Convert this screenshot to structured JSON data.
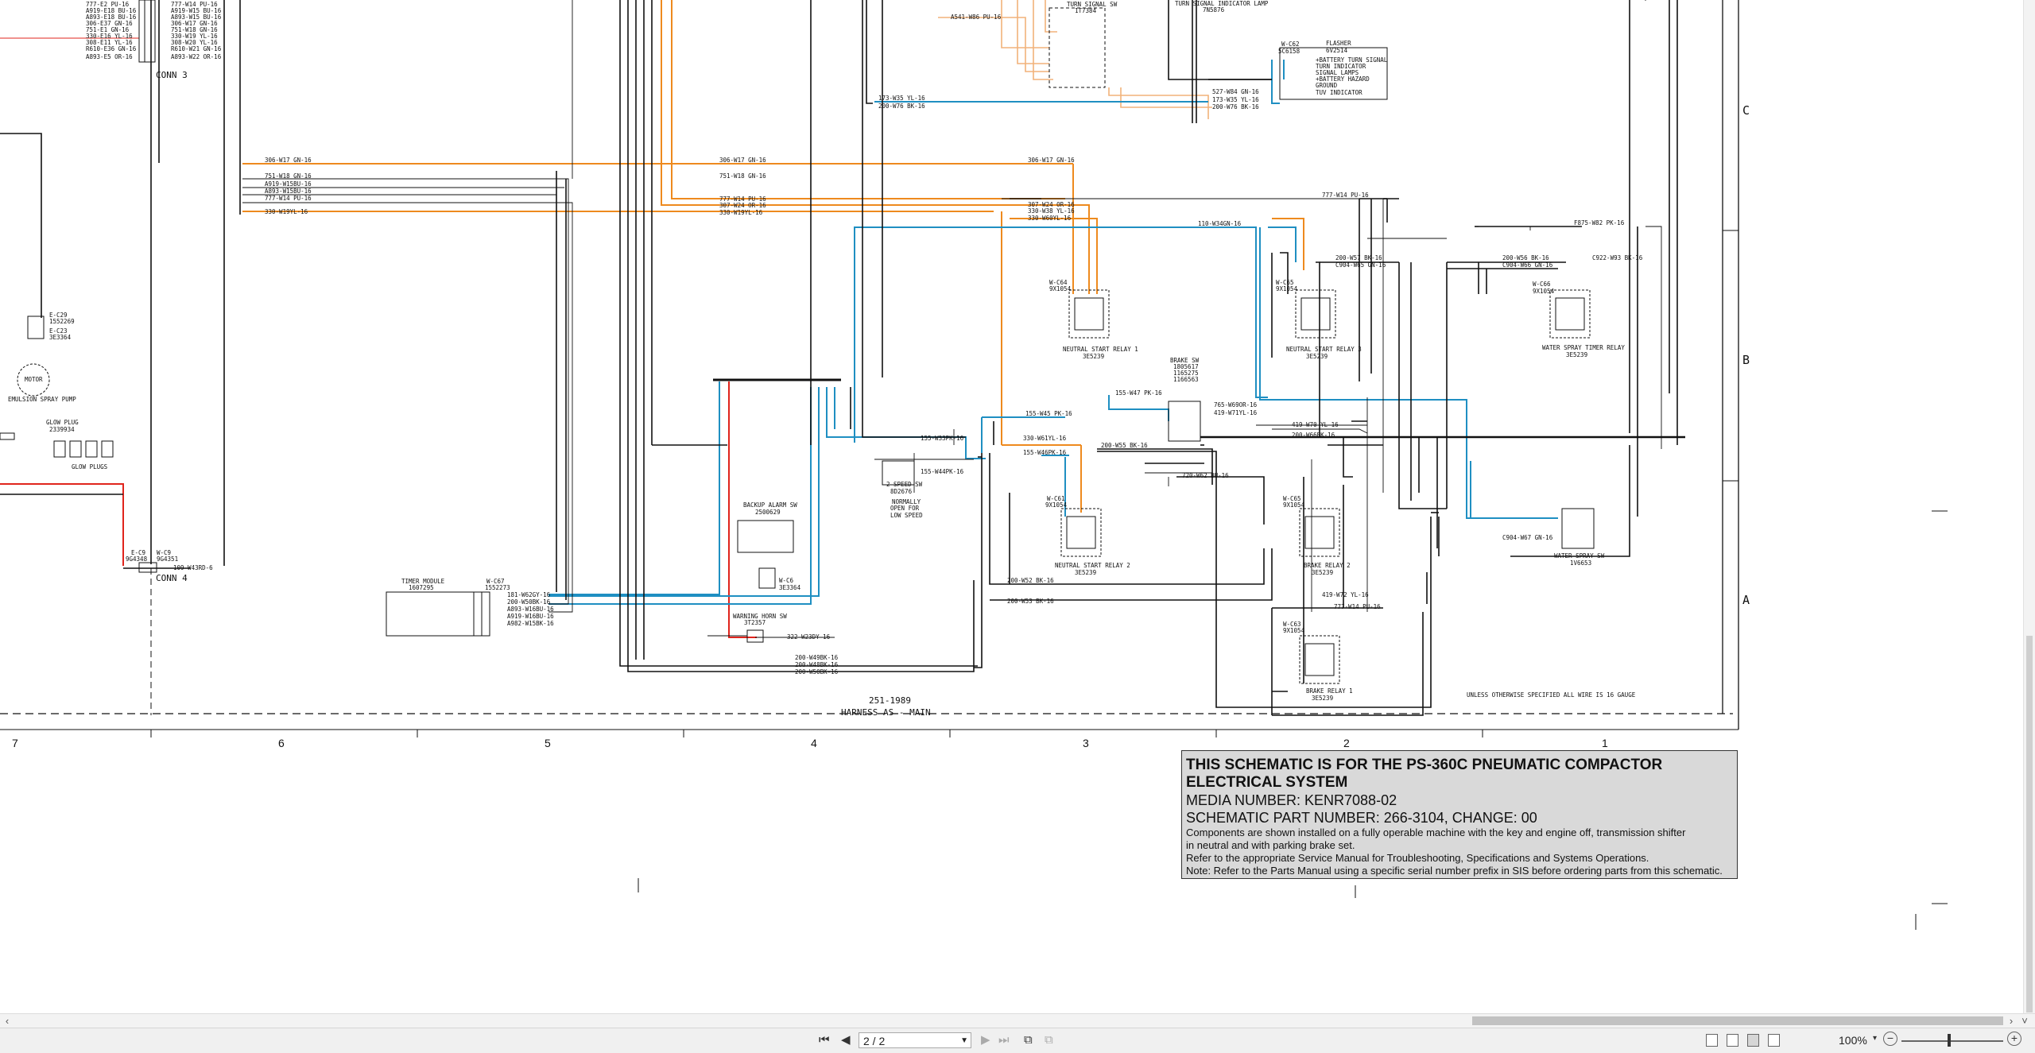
{
  "schematic": {
    "harness_number": "251-1989",
    "harness_name": "HARNESS AS - MAIN",
    "connectors": [
      "CONN 3",
      "CONN 4"
    ],
    "zone_rows": [
      "C",
      "B",
      "A"
    ],
    "zone_columns": [
      "7",
      "6",
      "5",
      "4",
      "3",
      "2",
      "1"
    ],
    "wire_colors": {
      "orange": "#ee8a1e",
      "light_orange": "#f2b27a",
      "blue": "#1f8fc2",
      "red": "#e0241c",
      "black": "#111111"
    },
    "wire_gauge_note": "UNLESS OTHERWISE SPECIFIED ALL WIRE IS 16 GAUGE",
    "components": {
      "turn_signal_sw": [
        "TURN SIGNAL SW",
        "1T7384"
      ],
      "turn_signal_lamp": [
        "TURN SIGNAL INDICATOR LAMP",
        "7N5876"
      ],
      "flasher": [
        "FLASHER",
        "6V2514"
      ],
      "flasher_pins": [
        "+BATTERY TURN SIGNAL",
        "TURN INDICATOR",
        "SIGNAL LAMPS",
        "+BATTERY HAZARD",
        "GROUND",
        "TUV INDICATOR"
      ],
      "emulsion_pump": "EMULSION SPRAY PUMP",
      "motor": "MOTOR",
      "glow_plug": [
        "GLOW PLUG",
        "2339934"
      ],
      "glow_plugs": "GLOW PLUGS",
      "neutral_start_relay_1": [
        "NEUTRAL START RELAY 1",
        "3E5239"
      ],
      "neutral_start_relay_2": [
        "NEUTRAL START RELAY 2",
        "3E5239"
      ],
      "neutral_start_relay_3": [
        "NEUTRAL START RELAY 3",
        "3E5239"
      ],
      "water_spray_timer_relay": [
        "WATER SPRAY TIMER RELAY",
        "3E5239"
      ],
      "brake_relay_1": [
        "BRAKE RELAY 1",
        "3E5239"
      ],
      "brake_relay_2": [
        "BRAKE RELAY 2",
        "3E5239"
      ],
      "brake_sw": [
        "BRAKE SW",
        "1805617",
        "1165275",
        "1166563"
      ],
      "two_speed_sw": [
        "2 SPEED SW",
        "8D2676"
      ],
      "two_speed_note": [
        "NORMALLY",
        "OPEN FOR",
        "LOW SPEED"
      ],
      "water_spray_sw": [
        "WATER SPRAY SW",
        "1V6653"
      ],
      "backup_alarm_sw": [
        "BACKUP ALARM SW",
        "2500629"
      ],
      "warning_horn_sw": [
        "WARNING HORN SW",
        "3T2357"
      ],
      "timer_module": [
        "TIMER MODULE",
        "1607295"
      ]
    },
    "wire_labels": {
      "conn3": [
        "777-E2 PU-16",
        "A919-E18 BU-16",
        "A893-E18 BU-16",
        "306-E37 GN-16",
        "751-E1 GN-16",
        "330-E16 YL-16",
        "308-E11 YL-16",
        "R610-E36 GN-16",
        "A893-E5 OR-16"
      ],
      "conn3_right": [
        "777-W14 PU-16",
        "A919-W15 BU-16",
        "A893-W15 BU-16",
        "306-W17 GN-16",
        "751-W18 GN-16",
        "330-W19 YL-16",
        "308-W20 YL-16",
        "R610-W21 GN-16",
        "A893-W22 OR-16"
      ],
      "main_left": [
        "306-W17 GN-16",
        "751-W18 GN-16",
        "A919-W15BU-16",
        "A893-W15BU-16",
        "777-W14 PU-16",
        "330-W19YL-16"
      ],
      "main_mid": [
        "306-W17 GN-16",
        "751-W18 GN-16",
        "777-W14 PU-16",
        "307-W24 OR-16",
        "330-W19YL-16"
      ],
      "main_right": [
        "306-W17 GN-16",
        "307-W24 OR-16",
        "330-W38 YL-16",
        "330-W60YL-16",
        "110-W34GN-16",
        "777-W14 PU-16"
      ],
      "top": [
        "A541-W86 PU-16",
        "173-W35 YL-16",
        "200-W76 BK-16",
        "527-W84 GN-16",
        "173-W35 YL-16",
        "200-W76 BK-16"
      ],
      "right": [
        "F875-W82 PK-16",
        "200-W56 BK-16",
        "C904-W66 GN-16",
        "C922-W93 BK-16",
        "200-W57 BK-16",
        "C904-W65 GN-16"
      ],
      "center": [
        "155-W47 PK-16",
        "765-W69OR-16",
        "419-W71YL-16",
        "155-W45 PK-16",
        "419-W70 YL-16",
        "155-W33PK-16",
        "330-W61YL-16",
        "200-W66BK-16",
        "155-W46PK-16",
        "200-W55 BK-16",
        "155-W44PK-16",
        "720-W62 BU-16",
        "200-W52 BK-16",
        "200-W53 BK-16",
        "419-W72 YL-16",
        "777-W14 PU-16",
        "C904-W67 GN-16"
      ],
      "timer": [
        "181-W62GY-16",
        "200-W50BK-16",
        "A893-W16BU-16",
        "A919-W16BU-16",
        "A982-W15BK-16"
      ],
      "bottom": [
        "322-W23DY-16",
        "200-W49BK-16",
        "200-W48BK-16",
        "200-W50BK-16"
      ],
      "conn4": "109-W43RD-6",
      "relay_ids": [
        "W-C64",
        "9X1054",
        "W-C65",
        "9X1054",
        "W-C66",
        "9X1054",
        "W-C61",
        "9X1054",
        "W-C65",
        "9X1054",
        "W-C63",
        "9X1054",
        "W-C67",
        "1552273",
        "W-C6",
        "3E3364",
        "E-C9",
        "9G4348",
        "W-C9",
        "9G4351",
        "W-C62",
        "5C6158",
        "E-C29",
        "1552269",
        "E-C23",
        "3E3364"
      ]
    }
  },
  "title_block": {
    "line1": "THIS SCHEMATIC IS FOR THE PS-360C PNEUMATIC COMPACTOR",
    "line2": "ELECTRICAL SYSTEM",
    "line3": "MEDIA NUMBER: KENR7088-02",
    "line4": "SCHEMATIC PART NUMBER: 266-3104, CHANGE: 00",
    "line5": "Components are shown installed on a fully operable machine with the key and engine off, transmission shifter",
    "line6": "in neutral and with parking brake set.",
    "line7": "Refer to the appropriate Service Manual for Troubleshooting, Specifications and Systems Operations.",
    "line8": "Note: Refer to the Parts Manual using a specific serial number prefix in SIS before ordering parts from this schematic."
  },
  "toolbar": {
    "page_value": "2 / 2",
    "zoom": "100%"
  },
  "icons": [
    "first-page-icon",
    "prev-page-icon",
    "next-page-icon",
    "last-page-icon",
    "rotate-icon",
    "two-page-icon",
    "single-page-view-icon",
    "continuous-view-icon",
    "facing-view-icon",
    "scroll-view-icon",
    "zoom-out-icon",
    "zoom-in-icon"
  ]
}
